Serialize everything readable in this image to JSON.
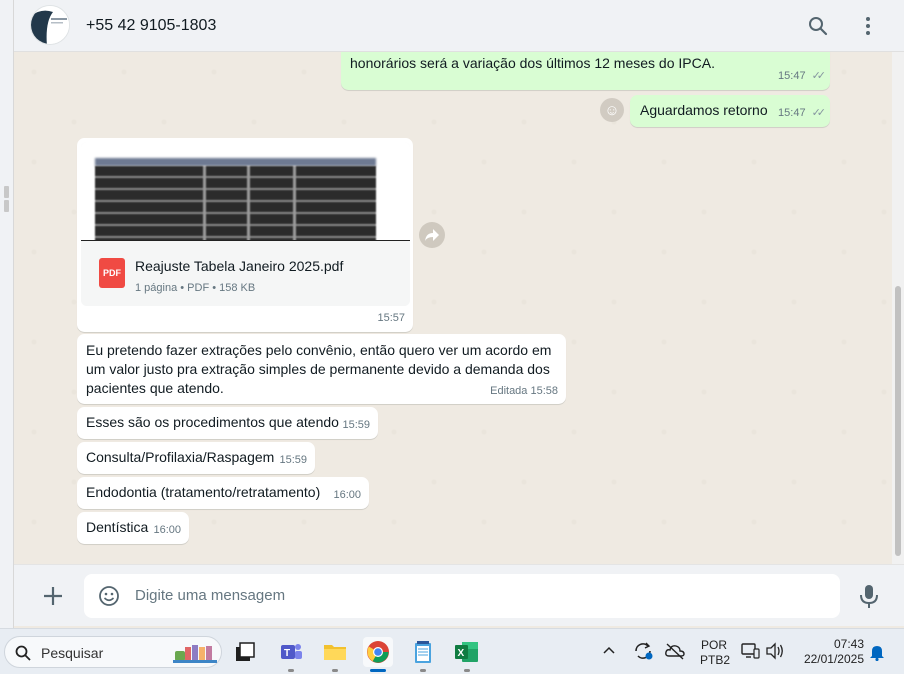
{
  "header": {
    "contact": "+55 42 9105-1803",
    "search_icon": "search-icon",
    "menu_icon": "kebab-menu-icon"
  },
  "messages": {
    "out_partial": "honorários será a variação dos últimos 12 meses do IPCA.",
    "out_partial_time": "15:47",
    "out_2": "Aguardamos retorno",
    "out_2_time": "15:47",
    "pdf": {
      "filename": "Reajuste Tabela Janeiro 2025.pdf",
      "meta": "1 página • PDF • 158 KB",
      "badge": "PDF",
      "time": "15:57"
    },
    "in_1": "Eu pretendo fazer extrações pelo convênio, então quero ver um acordo em um valor justo pra extração simples de permanente devido a demanda dos pacientes que atendo.",
    "in_1_time": "Editada 15:58",
    "in_2": "Esses são os procedimentos que atendo",
    "in_2_time": "15:59",
    "in_3": "Consulta/Profilaxia/Raspagem",
    "in_3_time": "15:59",
    "in_4": "Endodontia (tratamento/retratamento)",
    "in_4_time": "16:00",
    "in_5": "Dentística",
    "in_5_time": "16:00"
  },
  "composer": {
    "placeholder": "Digite uma mensagem"
  },
  "taskbar": {
    "search_label": "Pesquisar",
    "lang_top": "POR",
    "lang_bottom": "PTB2",
    "time": "07:43",
    "date": "22/01/2025"
  },
  "colors": {
    "outgoing": "#d9fdd3",
    "incoming": "#ffffff",
    "chat_bg": "#efeae2",
    "pdf_red": "#f04a43"
  }
}
